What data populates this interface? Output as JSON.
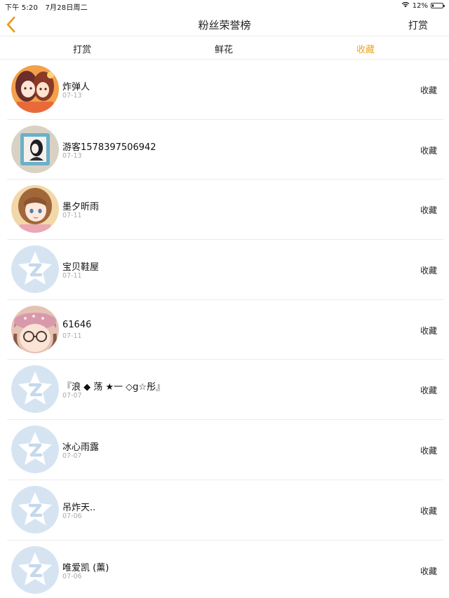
{
  "status": {
    "time": "下午 5:20",
    "date": "7月28日周二",
    "battery": "12%",
    "battery_level": 0.12
  },
  "nav": {
    "title": "粉丝荣誉榜",
    "action": "打赏",
    "accent_color": "#f0a21f"
  },
  "tabs": [
    {
      "label": "打赏",
      "active": false
    },
    {
      "label": "鲜花",
      "active": false
    },
    {
      "label": "收藏",
      "active": true
    }
  ],
  "rows": [
    {
      "name": "炸弹人",
      "date": "07-13",
      "action": "收藏",
      "avatar": "anime-girls-avatar"
    },
    {
      "name": "游客1578397506942",
      "date": "07-13",
      "action": "收藏",
      "avatar": "framed-portrait-avatar"
    },
    {
      "name": "墨夕昕雨",
      "date": "07-11",
      "action": "收藏",
      "avatar": "anime-girl-avatar"
    },
    {
      "name": "宝贝鞋屋",
      "date": "07-11",
      "action": "收藏",
      "avatar": "default-star-avatar"
    },
    {
      "name": "61646",
      "date": "07-11",
      "action": "收藏",
      "avatar": "glasses-girl-avatar"
    },
    {
      "name": "『浪 ◆ 荡 ★一 ◇g☆彤』",
      "date": "07-07",
      "action": "收藏",
      "avatar": "default-star-avatar"
    },
    {
      "name": "冰心雨露",
      "date": "07-07",
      "action": "收藏",
      "avatar": "default-star-avatar"
    },
    {
      "name": "吊炸天..",
      "date": "07-06",
      "action": "收藏",
      "avatar": "default-star-avatar"
    },
    {
      "name": "唯爱凯 (薰)",
      "date": "07-06",
      "action": "收藏",
      "avatar": "default-star-avatar"
    }
  ]
}
